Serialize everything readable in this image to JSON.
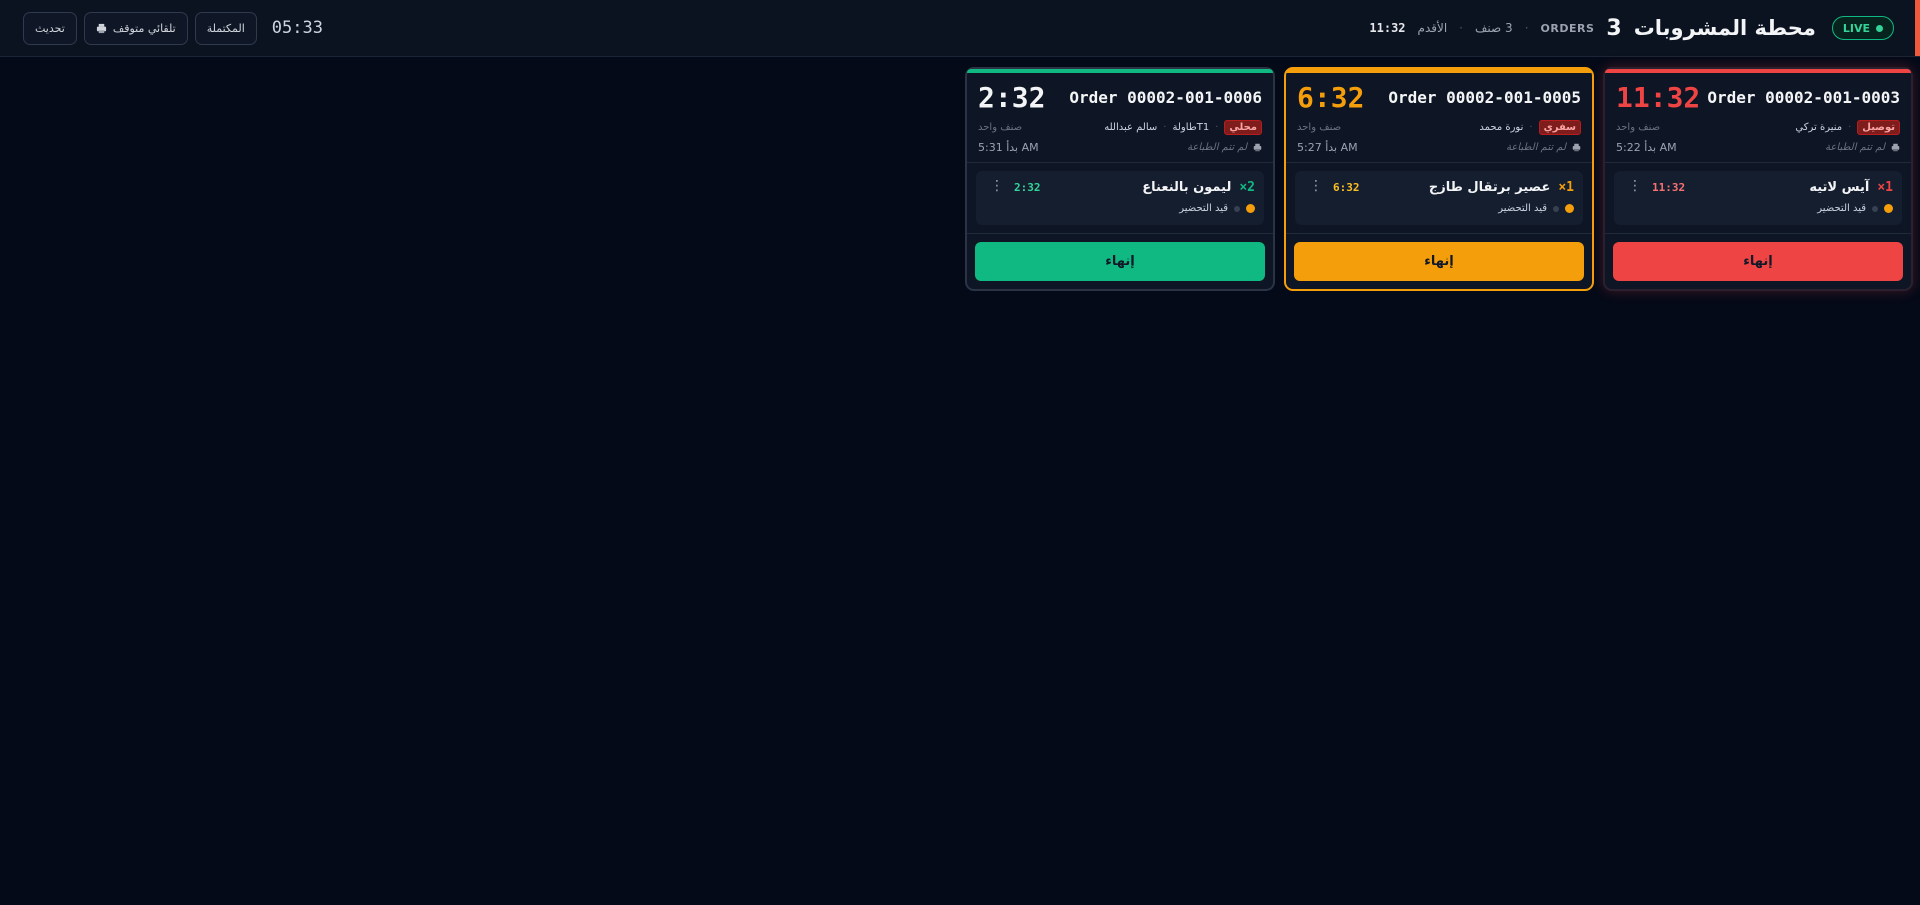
{
  "header": {
    "live_label": "LIVE",
    "title": "محطة المشروبات",
    "orders_count": "3",
    "orders_label": "ORDERS",
    "items_summary": "3 صنف",
    "oldest_label": "الأقدم",
    "oldest_value": "11:32",
    "clock": "05:33",
    "buttons": {
      "completed": "المكتملة",
      "auto_print": "تلقائي متوقف",
      "refresh": "تحديث"
    }
  },
  "colors": {
    "late": "#ef4444",
    "warn": "#f59e0b",
    "ok": "#10b981"
  },
  "orders": [
    {
      "timer": "11:32",
      "order_no": "Order 00002-001-0003",
      "type_tag": "توصيل",
      "customer": "منيرة تركي",
      "table": "",
      "items_count": "صنف واحد",
      "print_state": "لم تتم الطباعة",
      "started": "بدأ 5:22 AM",
      "items": [
        {
          "qty": "1×",
          "name": "آيس لاتيه",
          "status": "قيد التحضير",
          "timer": "11:32"
        }
      ],
      "finish_label": "إنهاء"
    },
    {
      "timer": "6:32",
      "order_no": "Order 00002-001-0005",
      "type_tag": "سفري",
      "customer": "نورة محمد",
      "table": "",
      "items_count": "صنف واحد",
      "print_state": "لم تتم الطباعة",
      "started": "بدأ 5:27 AM",
      "items": [
        {
          "qty": "1×",
          "name": "عصير برتقال طازج",
          "status": "قيد التحضير",
          "timer": "6:32"
        }
      ],
      "finish_label": "إنهاء"
    },
    {
      "timer": "2:32",
      "order_no": "Order 00002-001-0006",
      "type_tag": "محلي",
      "customer": "سالم عبدالله",
      "table": "T1طاولة",
      "items_count": "صنف واحد",
      "print_state": "لم تتم الطباعة",
      "started": "بدأ 5:31 AM",
      "items": [
        {
          "qty": "2×",
          "name": "ليمون بالنعناع",
          "status": "قيد التحضير",
          "timer": "2:32"
        }
      ],
      "finish_label": "إنهاء"
    }
  ]
}
